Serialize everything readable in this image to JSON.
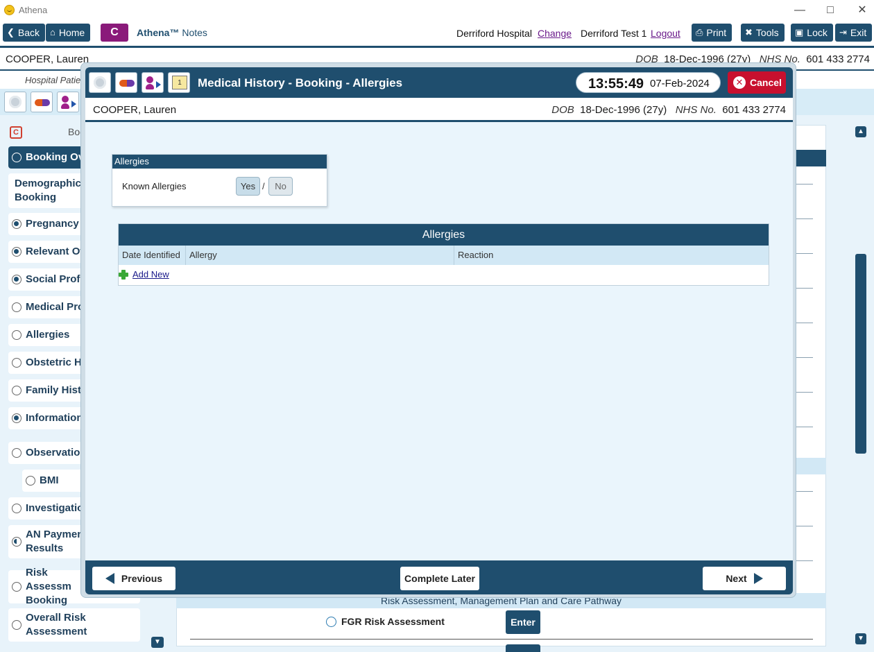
{
  "window": {
    "title": "Athena"
  },
  "toolbar": {
    "back_label": "Back",
    "home_label": "Home",
    "c_label": "C",
    "app_name": "Athena™",
    "app_sub": "Notes",
    "hospital": "Derriford Hospital",
    "change_link": "Change",
    "user": "Derriford Test 1",
    "logout_link": "Logout",
    "print_label": "Print",
    "tools_label": "Tools",
    "lock_label": "Lock",
    "exit_label": "Exit"
  },
  "patient": {
    "name": "COOPER, Lauren",
    "dob_label": "DOB",
    "dob": "18-Dec-1996 (27y)",
    "nhs_label": "NHS No.",
    "nhs": "601 433 2774"
  },
  "subline": {
    "text": "Hospital Patie"
  },
  "leftpanel": {
    "header": "Boo",
    "items": [
      {
        "label": "Booking Ov",
        "state": "empty",
        "active": true
      },
      {
        "label": "Demographics Booking",
        "state": "none"
      },
      {
        "label": "Pregnancy P",
        "state": "filled"
      },
      {
        "label": "Relevant Oth",
        "state": "filled"
      },
      {
        "label": "Social Profil",
        "state": "filled"
      },
      {
        "label": "Medical Pro",
        "state": "empty"
      },
      {
        "label": "Allergies",
        "state": "empty"
      },
      {
        "label": "Obstetric Hi",
        "state": "empty"
      },
      {
        "label": "Family Histo",
        "state": "empty"
      },
      {
        "label": "Information",
        "state": "filled"
      },
      {
        "label": "Observation",
        "state": "empty"
      },
      {
        "label": "BMI",
        "state": "empty"
      },
      {
        "label": "Investigation",
        "state": "empty"
      },
      {
        "label": "AN Payment Results",
        "state": "half"
      },
      {
        "label": "Risk Assessm Booking",
        "state": "empty"
      },
      {
        "label": "Overall Risk Assessment",
        "state": "empty"
      }
    ]
  },
  "background": {
    "risk_header": "Risk Assessment, Management Plan and Care Pathway",
    "fgr_label": "FGR Risk Assessment",
    "enter_label": "Enter"
  },
  "modal": {
    "title": "Medical History - Booking - Allergies",
    "time": "13:55:49",
    "date": "07-Feb-2024",
    "cancel_label": "Cancel",
    "calendar_day": "1",
    "allergy_box": {
      "header": "Allergies",
      "label": "Known Allergies",
      "yes": "Yes",
      "separator": "/",
      "no": "No",
      "selected": "Yes"
    },
    "table": {
      "title": "Allergies",
      "columns": [
        "Date Identified",
        "Allergy",
        "Reaction"
      ],
      "rows": [],
      "add_new": "Add New"
    },
    "footer": {
      "previous": "Previous",
      "complete_later": "Complete Later",
      "next": "Next"
    }
  },
  "colors": {
    "primary": "#1f4e6e",
    "cancel": "#c8102e",
    "c_button": "#8a1a7a",
    "light_bg": "#e8f3fa",
    "header_band": "#d2e8f5"
  }
}
